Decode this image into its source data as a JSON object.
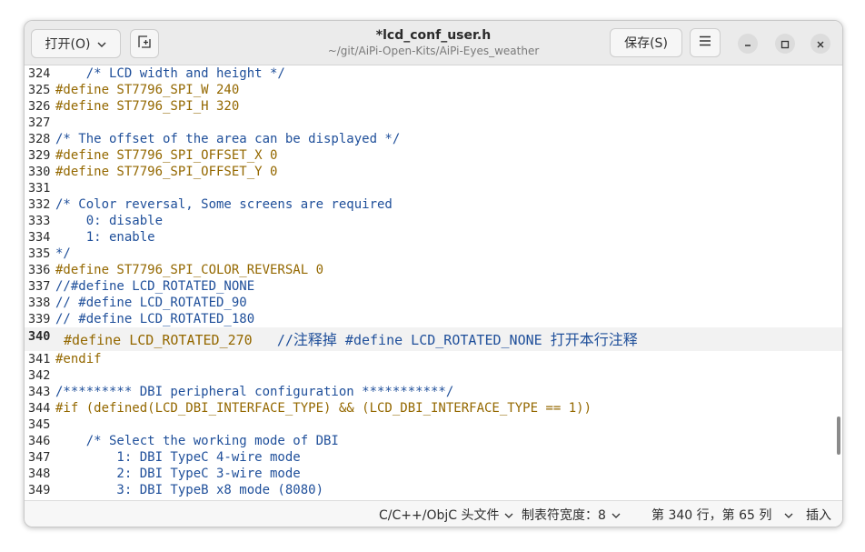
{
  "window": {
    "title": "*lcd_conf_user.h",
    "subtitle": "~/git/AiPi-Open-Kits/AiPi-Eyes_weather"
  },
  "header": {
    "open_label": "打开(O)",
    "save_label": "保存(S)"
  },
  "icons": {
    "open_dropdown": "chevron-down-icon",
    "new_tab": "new-tab-icon",
    "menu": "hamburger-menu-icon",
    "minimize": "minimize-icon",
    "maximize": "maximize-icon",
    "close": "close-icon"
  },
  "editor": {
    "current_line": "340",
    "lines": [
      {
        "num": "324",
        "kind": "comment",
        "text": "    /* LCD width and height */"
      },
      {
        "num": "325",
        "kind": "pp",
        "text": "#define ST7796_SPI_W 240"
      },
      {
        "num": "326",
        "kind": "pp",
        "text": "#define ST7796_SPI_H 320"
      },
      {
        "num": "327",
        "kind": "plain",
        "text": ""
      },
      {
        "num": "328",
        "kind": "comment",
        "text": "/* The offset of the area can be displayed */"
      },
      {
        "num": "329",
        "kind": "pp",
        "text": "#define ST7796_SPI_OFFSET_X 0"
      },
      {
        "num": "330",
        "kind": "pp",
        "text": "#define ST7796_SPI_OFFSET_Y 0"
      },
      {
        "num": "331",
        "kind": "plain",
        "text": ""
      },
      {
        "num": "332",
        "kind": "comment",
        "text": "/* Color reversal, Some screens are required"
      },
      {
        "num": "333",
        "kind": "comment",
        "text": "    0: disable"
      },
      {
        "num": "334",
        "kind": "comment",
        "text": "    1: enable"
      },
      {
        "num": "335",
        "kind": "comment",
        "text": "*/"
      },
      {
        "num": "336",
        "kind": "pp",
        "text": "#define ST7796_SPI_COLOR_REVERSAL 0"
      },
      {
        "num": "337",
        "kind": "comment",
        "text": "//#define LCD_ROTATED_NONE"
      },
      {
        "num": "338",
        "kind": "comment",
        "text": "// #define LCD_ROTATED_90"
      },
      {
        "num": "339",
        "kind": "comment",
        "text": "// #define LCD_ROTATED_180"
      },
      {
        "num": "340",
        "kind": "current",
        "text": "#define LCD_ROTATED_270   ",
        "comment": "//注释掉 #define LCD_ROTATED_NONE 打开本行注释"
      },
      {
        "num": "341",
        "kind": "pp",
        "text": "#endif"
      },
      {
        "num": "342",
        "kind": "plain",
        "text": ""
      },
      {
        "num": "343",
        "kind": "comment",
        "text": "/********* DBI peripheral configuration ***********/"
      },
      {
        "num": "344",
        "kind": "pp",
        "text": "#if (defined(LCD_DBI_INTERFACE_TYPE) && (LCD_DBI_INTERFACE_TYPE == 1))"
      },
      {
        "num": "345",
        "kind": "plain",
        "text": ""
      },
      {
        "num": "346",
        "kind": "comment",
        "text": "    /* Select the working mode of DBI"
      },
      {
        "num": "347",
        "kind": "comment",
        "text": "        1: DBI TypeC 4-wire mode"
      },
      {
        "num": "348",
        "kind": "comment",
        "text": "        2: DBI TypeC 3-wire mode"
      },
      {
        "num": "349",
        "kind": "comment",
        "text": "        3: DBI TypeB x8 mode (8080)"
      }
    ]
  },
  "statusbar": {
    "language": "C/C++/ObjC 头文件",
    "tab_width": "制表符宽度：8",
    "position": "第 340 行，第 65 列",
    "insert_mode": "插入"
  },
  "colors": {
    "comment": "#1f4f9a",
    "preprocessor": "#946800",
    "current_line_bg": "#f2f2f2"
  }
}
